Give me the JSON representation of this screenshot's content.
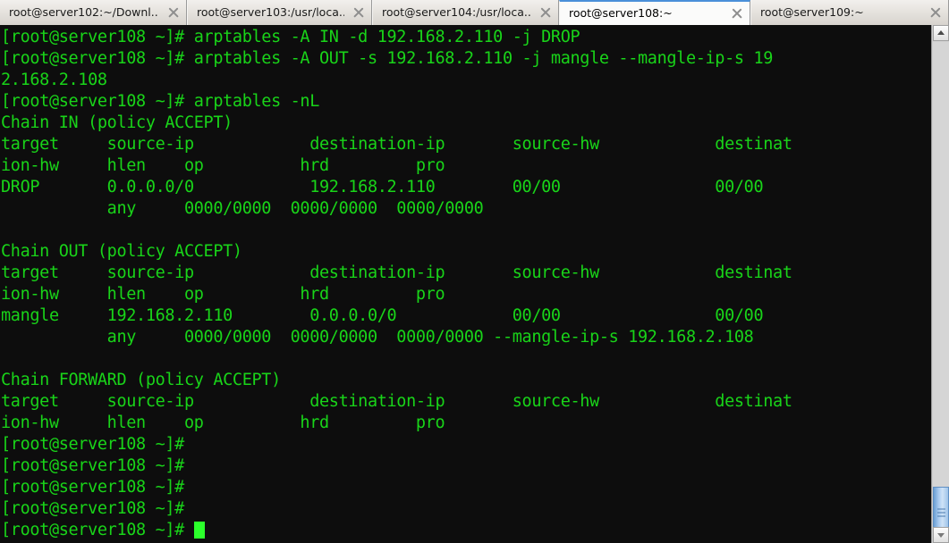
{
  "window": {
    "active_tab_index": 3
  },
  "tabs": [
    {
      "label": "root@server102:~/Downl...",
      "close_label": "Close tab"
    },
    {
      "label": "root@server103:/usr/loca...",
      "close_label": "Close tab"
    },
    {
      "label": "root@server104:/usr/loca...",
      "close_label": "Close tab"
    },
    {
      "label": "root@server108:~",
      "close_label": "Close tab"
    },
    {
      "label": "root@server109:~",
      "close_label": "Close tab"
    }
  ],
  "terminal": {
    "prompt": "[root@server108 ~]#",
    "foreground_color": "#19d419",
    "background_color": "#0d0d0d",
    "cursor_color": "#2bff2b",
    "lines": [
      "[root@server108 ~]# arptables -A IN -d 192.168.2.110 -j DROP",
      "[root@server108 ~]# arptables -A OUT -s 192.168.2.110 -j mangle --mangle-ip-s 19",
      "2.168.2.108",
      "[root@server108 ~]# arptables -nL",
      "Chain IN (policy ACCEPT)",
      "target     source-ip            destination-ip       source-hw            destinat",
      "ion-hw     hlen    op          hrd         pro",
      "DROP       0.0.0.0/0            192.168.2.110        00/00                00/00",
      "           any     0000/0000  0000/0000  0000/0000",
      "",
      "Chain OUT (policy ACCEPT)",
      "target     source-ip            destination-ip       source-hw            destinat",
      "ion-hw     hlen    op          hrd         pro",
      "mangle     192.168.2.110        0.0.0.0/0            00/00                00/00",
      "           any     0000/0000  0000/0000  0000/0000 --mangle-ip-s 192.168.2.108",
      "",
      "Chain FORWARD (policy ACCEPT)",
      "target     source-ip            destination-ip       source-hw            destinat",
      "ion-hw     hlen    op          hrd         pro",
      "[root@server108 ~]#",
      "[root@server108 ~]#",
      "[root@server108 ~]#",
      "[root@server108 ~]#",
      "[root@server108 ~]# "
    ]
  },
  "scrollbar": {
    "up_arrow": "scroll-up",
    "down_arrow": "scroll-down"
  }
}
